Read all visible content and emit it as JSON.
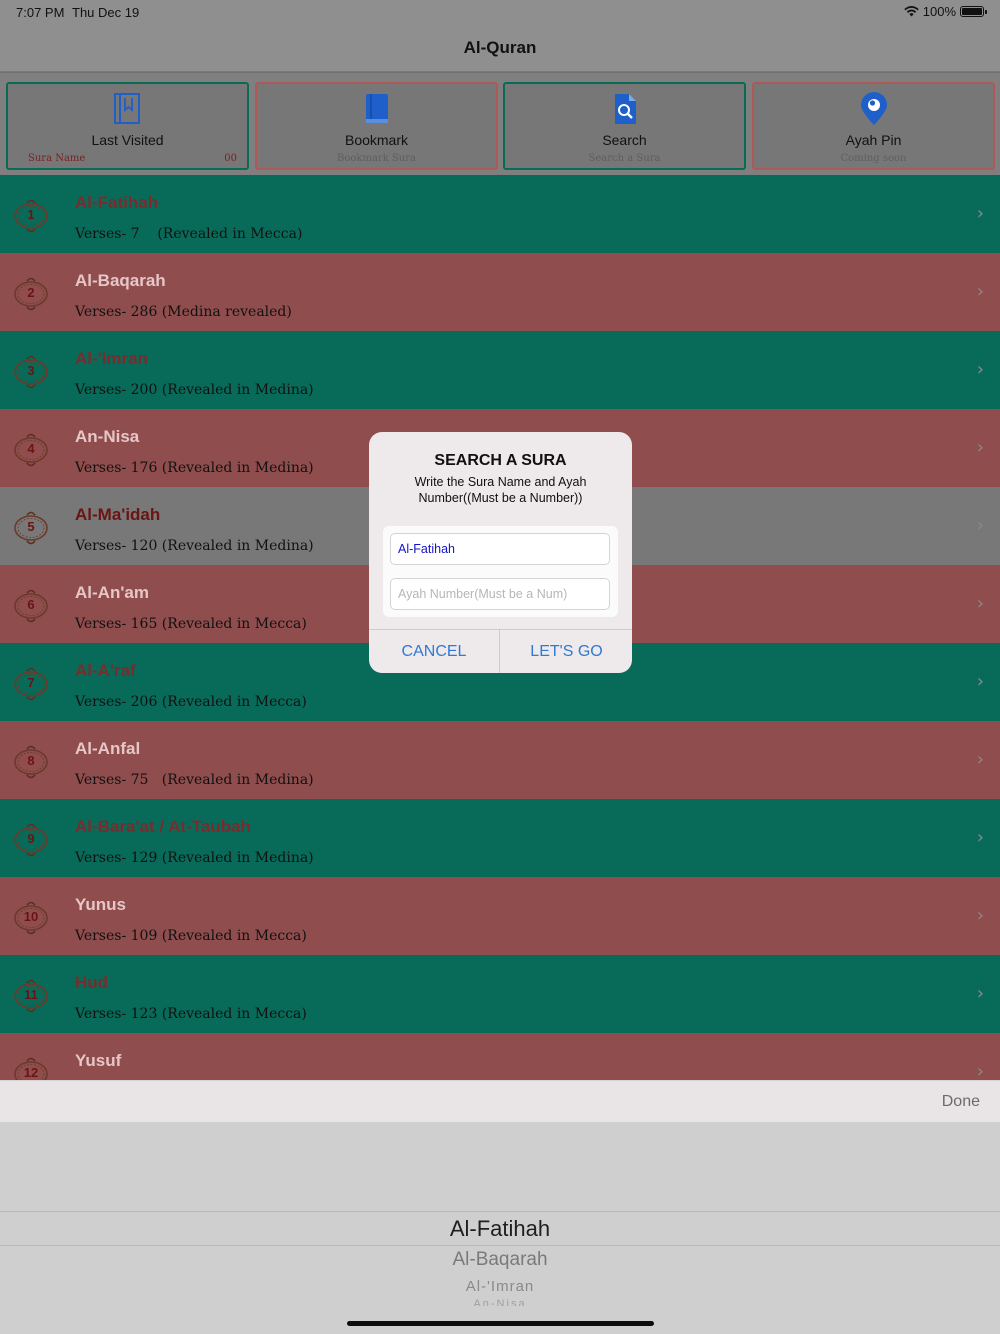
{
  "status": {
    "time": "7:07 PM",
    "date": "Thu Dec 19",
    "battery": "100%"
  },
  "nav": {
    "title": "Al-Quran"
  },
  "tiles": [
    {
      "label": "Last Visited",
      "sub_left": "Sura Name",
      "sub_right": "00",
      "icon": "bookmark-list-icon",
      "accent": "#0a6b55"
    },
    {
      "label": "Bookmark",
      "sub": "Bookmark Sura",
      "icon": "book-icon",
      "accent": "#b05858"
    },
    {
      "label": "Search",
      "sub": "Search a Sura",
      "icon": "file-search-icon",
      "accent": "#0a6b55"
    },
    {
      "label": "Ayah Pin",
      "sub": "Coming soon",
      "icon": "location-pin-icon",
      "accent": "#b05858"
    }
  ],
  "suras": [
    {
      "num": "1",
      "name": "Al-Fatihah",
      "info": "Verses- 7    (Revealed in Mecca)",
      "color": "green"
    },
    {
      "num": "2",
      "name": "Al-Baqarah",
      "info": "Verses- 286 (Medina revealed)",
      "color": "red"
    },
    {
      "num": "3",
      "name": "Al-'Imran",
      "info": "Verses- 200 (Revealed in Medina)",
      "color": "green"
    },
    {
      "num": "4",
      "name": "An-Nisa",
      "info": "Verses- 176 (Revealed in Medina)",
      "color": "red"
    },
    {
      "num": "5",
      "name": "Al-Ma'idah",
      "info": "Verses- 120 (Revealed in Medina)",
      "color": "gray"
    },
    {
      "num": "6",
      "name": "Al-An'am",
      "info": "Verses- 165 (Revealed in Mecca)",
      "color": "red"
    },
    {
      "num": "7",
      "name": "Al-A'raf",
      "info": "Verses- 206 (Revealed in Mecca)",
      "color": "green"
    },
    {
      "num": "8",
      "name": "Al-Anfal",
      "info": "Verses- 75   (Revealed in Medina)",
      "color": "red"
    },
    {
      "num": "9",
      "name": "Al-Bara'at / At-Taubah",
      "info": "Verses- 129 (Revealed in Medina)",
      "color": "green"
    },
    {
      "num": "10",
      "name": "Yunus",
      "info": "Verses- 109 (Revealed in Mecca)",
      "color": "red"
    },
    {
      "num": "11",
      "name": "Hud",
      "info": "Verses- 123 (Revealed in Mecca)",
      "color": "green"
    },
    {
      "num": "12",
      "name": "Yusuf",
      "info": "",
      "color": "red"
    }
  ],
  "alert": {
    "title": "SEARCH A SURA",
    "message": "Write the Sura Name and Ayah Number((Must be a Number))",
    "sura_value": "Al-Fatihah",
    "ayah_placeholder": "Ayah Number(Must be a Num)",
    "cancel_label": "CANCEL",
    "go_label": "LET'S GO"
  },
  "toolbar": {
    "done_label": "Done"
  },
  "picker": {
    "options": [
      "Al-Fatihah",
      "Al-Baqarah",
      "Al-'Imran",
      "An-Nisa"
    ]
  },
  "colors": {
    "green": "#086b59",
    "red": "#8f4d4e",
    "link": "#2f7ad6"
  }
}
